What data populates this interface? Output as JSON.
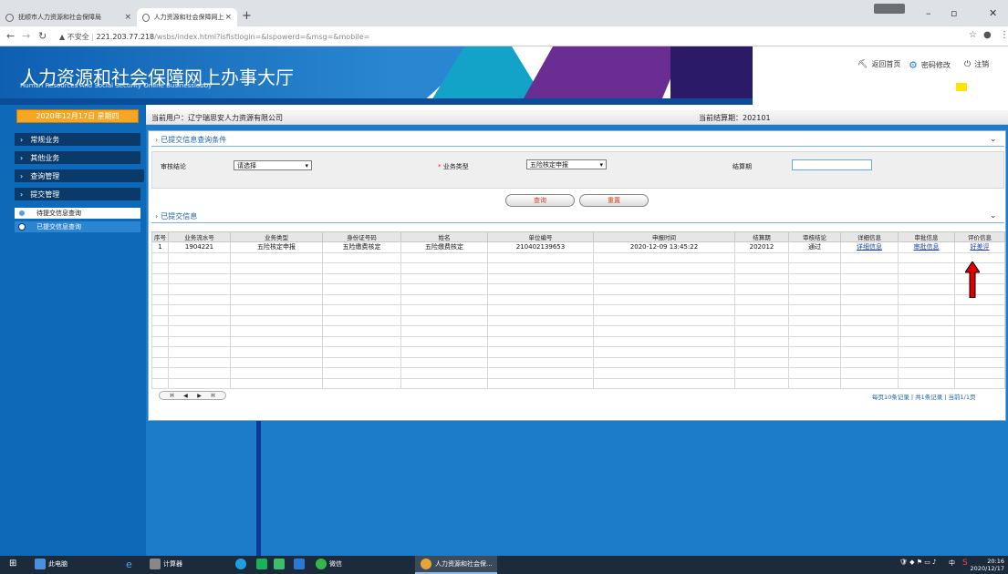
{
  "browser": {
    "tabs": [
      {
        "title": "抚顺市人力资源和社会保障局",
        "close": "×"
      },
      {
        "title": "人力资源和社会保障网上办事云",
        "close": "×"
      }
    ],
    "new_tab": "+",
    "url_security": "▲ 不安全",
    "url_host": "221.203.77.218",
    "url_path": "/wsbs/index.html?isfistlogin=&lspowerd=&msg=&mobile=",
    "win_min": "–",
    "win_max": "▫",
    "win_close": "✕"
  },
  "banner": {
    "title_cn": "人力资源和社会保障网上办事大厅",
    "title_en": "Human Resources And Social Security Online Businesslobby",
    "home_label": "返回首页",
    "password_label": "密码修改",
    "logout_label": "注销"
  },
  "sidebar": {
    "date": "2020年12月17日 星期四",
    "menus": [
      "常规业务",
      "其他业务",
      "查询管理",
      "提交管理"
    ],
    "subitems": [
      {
        "label": "待提交信息查询",
        "selected": false
      },
      {
        "label": "已提交信息查询",
        "selected": true
      }
    ]
  },
  "infobar": {
    "current_user": "当前用户：辽宁瑞思安人力资源有限公司",
    "current_period": "当前结算期：202101"
  },
  "query": {
    "section_title": "已提交信息查询条件",
    "audit_label": "审核结论",
    "audit_value": "请选择",
    "biz_type_req": "*",
    "biz_type_label": "业务类型",
    "biz_type_value": "五险核定申报",
    "period_label": "结算期",
    "search_button": "查询",
    "reset_button": "重置"
  },
  "results": {
    "section_title": "已提交信息",
    "columns": [
      "序号",
      "业务流水号",
      "业务类型",
      "身份证号码",
      "姓名",
      "单位编号",
      "申报时间",
      "结算期",
      "审核结论",
      "详细信息",
      "审批信息",
      "评价信息"
    ],
    "rows": [
      [
        "1",
        "1904221",
        "五险核定申报",
        "五险缴费核定",
        "五险缴费核定",
        "210402139653",
        "2020-12-09 13:45:22",
        "202012",
        "通过",
        "详细信息",
        "审批信息",
        "好差评"
      ]
    ],
    "empty_rows": 13,
    "pager_buttons": [
      "H",
      "◀",
      "▶",
      "H"
    ],
    "pager_info": "每页10条记录 | 共1条记录 | 当前1/1页"
  },
  "taskbar": {
    "this_pc": "此电脑",
    "calculator": "计算器",
    "wechat": "微信",
    "active_app": "人力资源和社会保...",
    "ime": "中",
    "time": "20:16",
    "date": "2020/12/17"
  },
  "colors": {
    "accent_blue": "#1d7cc9",
    "date_orange": "#f5a623",
    "annotation_red": "#e00000"
  }
}
